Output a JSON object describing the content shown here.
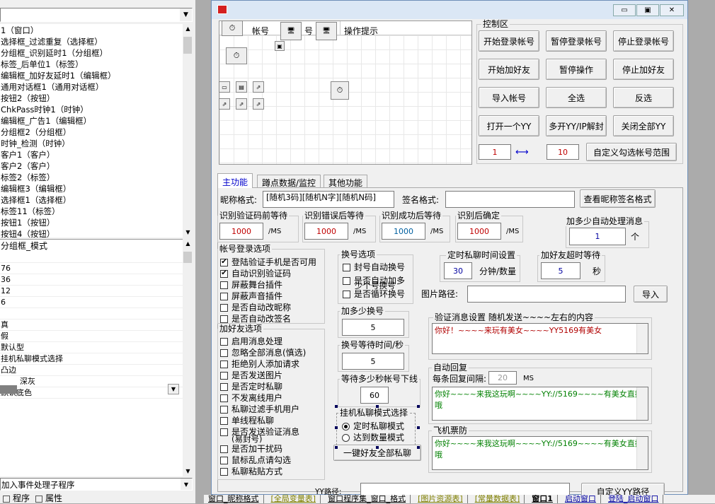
{
  "left_panel": {
    "combo_value": "",
    "tree_items": [
      "1（窗口）",
      "选择框_过滤重复（选择框）",
      "分组框_识别延时1（分组框）",
      "标签_后单位1（标签）",
      "编辑框_加好友延时1（编辑框）",
      "通用对话框1（通用对话框）",
      "按钮2（按钮）",
      "ChkPass时钟1（时钟）",
      "编辑框_广告1（编辑框）",
      "分组框2（分组框）",
      "时钟_检测（时钟）",
      "客户1（客户）",
      "客户2（客户）",
      "标签2（标签）",
      "编辑框3（编辑框）",
      "选择框1（选择框）",
      "标签11（标签）",
      "按钮1（按钮）",
      "按钮4（按钮）"
    ],
    "prop_header": "分组框_模式",
    "prop_rows": [
      "",
      "76",
      "36",
      "12",
      "6",
      "",
      "真",
      "假",
      "默认型",
      "挂机私聊模式选择",
      "凸边",
      "深灰",
      "默认底色"
    ],
    "event_combo": "加入事件处理子程序",
    "bottom_tabs": [
      "程序",
      "属性"
    ]
  },
  "window": {
    "minimize": "▭",
    "restore": "▣",
    "close": "✕"
  },
  "design_grid": {
    "col_account": "帐号",
    "col_num": "号",
    "col_hint": "操作提示"
  },
  "control_area": {
    "title": "控制区",
    "buttons": [
      "开始登录帐号",
      "暂停登录帐号",
      "停止登录帐号",
      "开始加好友",
      "暂停操作",
      "停止加好友",
      "导入帐号",
      "全选",
      "反选",
      "打开一个YY",
      "多开YY/IP解封",
      "关闭全部YY"
    ],
    "range_from": "1",
    "range_to": "10",
    "range_button": "自定义勾选帐号范围"
  },
  "tabs": [
    "主功能",
    "蹲点数据/监控",
    "其他功能"
  ],
  "main": {
    "nick_label": "昵称格式:",
    "nick_value": "[随机3码][随机N字][随机N码]",
    "sign_label": "签名格式:",
    "sign_value": "",
    "check_nick_button": "查看昵称签名格式",
    "waits": [
      {
        "cap": "识别验证码前等待",
        "value": "1000",
        "unit": "/MS"
      },
      {
        "cap": "识别错误后等待",
        "value": "1000",
        "unit": "/MS"
      },
      {
        "cap": "识别成功后等待",
        "value": "1000",
        "unit": "/MS"
      },
      {
        "cap": "识别后确定",
        "value": "1000",
        "unit": "/MS"
      }
    ],
    "auto_msg_cap": "加多少自动处理消息",
    "auto_msg_value": "1",
    "auto_msg_unit": "个",
    "login_group": "帐号登录选项",
    "login_opts": [
      {
        "label": "登陆验证手机是否可用",
        "checked": true
      },
      {
        "label": "自动识别验证码",
        "checked": true
      },
      {
        "label": "屏蔽舞台插件",
        "checked": false
      },
      {
        "label": "屏蔽声音插件",
        "checked": false
      },
      {
        "label": "是否自动改昵称",
        "checked": false
      },
      {
        "label": "是否自动改签名",
        "checked": false
      }
    ],
    "friend_group": "加好友选项",
    "friend_opts": [
      "启用消息处理",
      "忽略全部消息(慎选)",
      "拒绝别人添加请求",
      "是否发送图片",
      "是否定时私聊",
      "不发离线用户",
      "私聊过滤手机用户",
      "单线程私聊",
      "是否发送验证消息",
      "是否加干扰码",
      "鼠标乱点请勾选",
      "私聊粘贴方式"
    ],
    "friend_opt_sub": "(易封号)",
    "switch_group": "换号选项",
    "switch_opts": [
      "封号自动换号",
      "是否自动加多",
      "是否循环换号"
    ],
    "switch_opt_overlap": "少个号换号",
    "switch_count_cap": "加多少换号",
    "switch_count_value": "5",
    "switch_wait_cap": "换号等待时间/秒",
    "switch_wait_value": "5",
    "offline_cap": "等待多少秒帐号下线",
    "offline_value": "60",
    "mode_group": "挂机私聊模式选择",
    "mode_opts": [
      {
        "label": "定时私聊模式",
        "selected": true
      },
      {
        "label": "达到数量模式",
        "selected": false
      }
    ],
    "one_key_button": "一键好友全部私聊",
    "timer_cap": "定时私聊时间设置",
    "timer_value": "30",
    "timer_unit": "分钟/数量",
    "friend_timeout_cap": "加好友超时等待",
    "friend_timeout_value": "5",
    "friend_timeout_unit": "秒",
    "image_path_label": "图片路径:",
    "import_button": "导入",
    "verify_cap": "验证消息设置 随机发送~~~~左右的内容",
    "verify_text": "你好！~~~~来玩有美女~~~~YY5169有美女",
    "reply_cap": "自动回复",
    "reply_interval_label": "每条回复间隔:",
    "reply_interval_value": "20",
    "reply_interval_unit": "MS",
    "reply_text": "你好~~~~来我这玩啊~~~~YY://5169~~~~有美女直播哦",
    "plane_cap": "飞机票防",
    "plane_text": "你好~~~~来我这玩啊~~~~YY://5169~~~~有美女直播哦",
    "yy_path_label": "YY路径:",
    "custom_yy_button": "自定义YY路径"
  },
  "bottom_tabs": [
    "窗口_昵称格式",
    "[全局变量表]",
    "窗口程序集_窗口_格式",
    "[图片资源表]",
    "[常量数据表]",
    "窗口1",
    "启动窗口",
    "登陆_启动窗口"
  ],
  "colors": {
    "verify_text": "#b00000",
    "reply_text": "#008000",
    "plane_text": "#008000",
    "input_text_blue": "#0000a0",
    "input_text_red": "#c00000",
    "accent": "#0000ff"
  }
}
